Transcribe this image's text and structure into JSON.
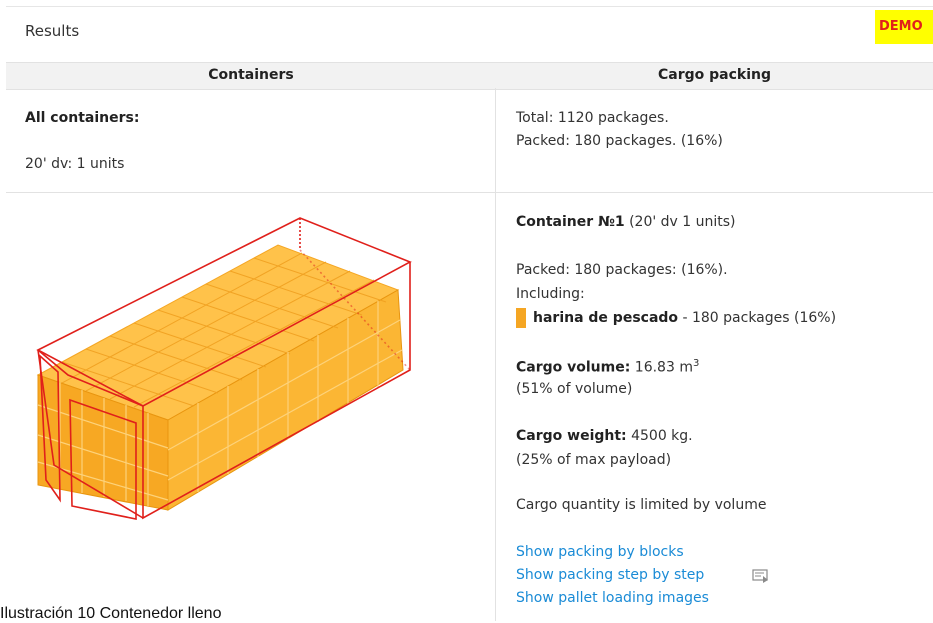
{
  "header": {
    "title": "Results",
    "demo_badge": "DEMO"
  },
  "table": {
    "col_containers": "Containers",
    "col_cargo": "Cargo packing"
  },
  "summary": {
    "all_containers_label": "All containers:",
    "container_type": "20' dv: 1 units",
    "total": "Total: 1120 packages.",
    "packed": "Packed: 180 packages. (16%)"
  },
  "container1": {
    "title": "Container №1",
    "title_detail": " (20' dv 1 units)",
    "packed": "Packed: 180 packages: (16%).",
    "including": "Including:",
    "cargo_name": "harina de pescado",
    "cargo_detail": " - 180 packages (16%)",
    "cargo_color": "#f5a623",
    "volume_label": "Cargo volume:",
    "volume_value": " 16.83 m",
    "volume_exp": "3",
    "volume_percent": "(51% of volume)",
    "weight_label": "Cargo weight:",
    "weight_value": " 4500 kg.",
    "weight_percent": "(25% of max payload)",
    "limit_note": "Cargo quantity is limited by volume"
  },
  "links": {
    "by_blocks": "Show packing by blocks",
    "step_by_step": "Show packing step by step",
    "pallet_images": "Show pallet loading images"
  },
  "caption": "Ilustración 10 Contenedor lleno",
  "colors": {
    "cargo_orange": "#f5a623",
    "container_outline": "#e0201b",
    "link_blue": "#1a8bd6",
    "demo_bg": "#ffff00"
  }
}
